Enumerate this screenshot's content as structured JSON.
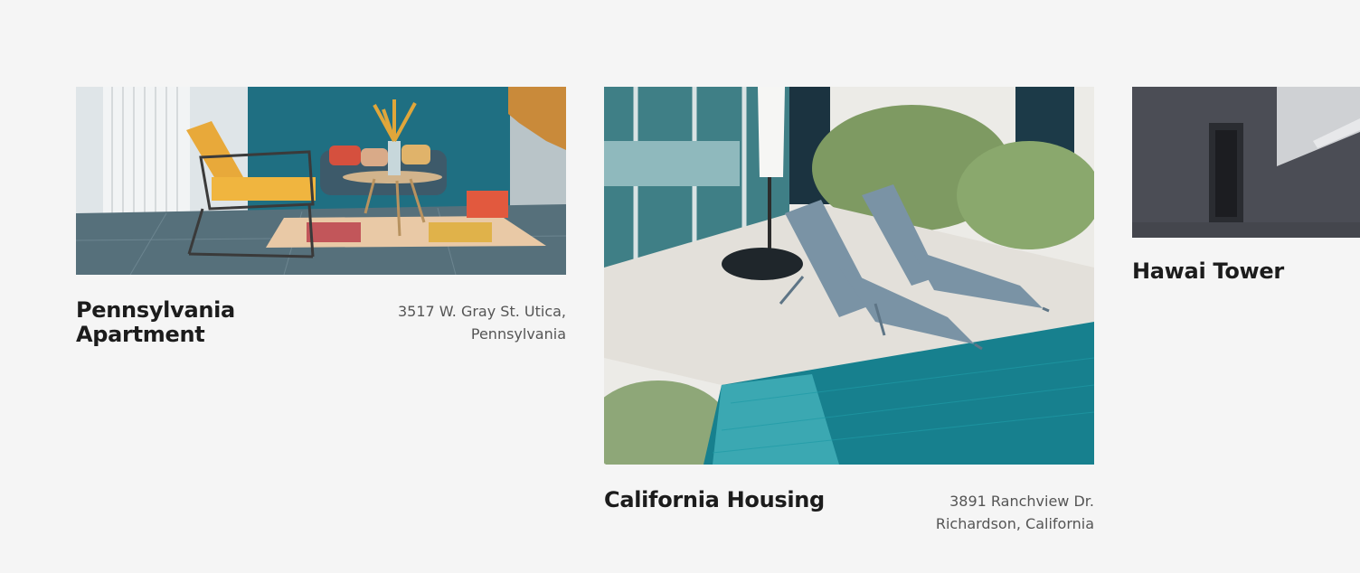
{
  "listings": [
    {
      "title": "Pennsylvania Apartment",
      "address_line1": "3517 W. Gray St. Utica,",
      "address_line2": "Pennsylvania",
      "photo": "living-room-photo"
    },
    {
      "title": "California Housing",
      "address_line1": "3891 Ranchview Dr.",
      "address_line2": "Richardson, California",
      "photo": "pool-deck-photo"
    },
    {
      "title": "Hawai Tower",
      "photo": "building-facade-photo"
    }
  ]
}
